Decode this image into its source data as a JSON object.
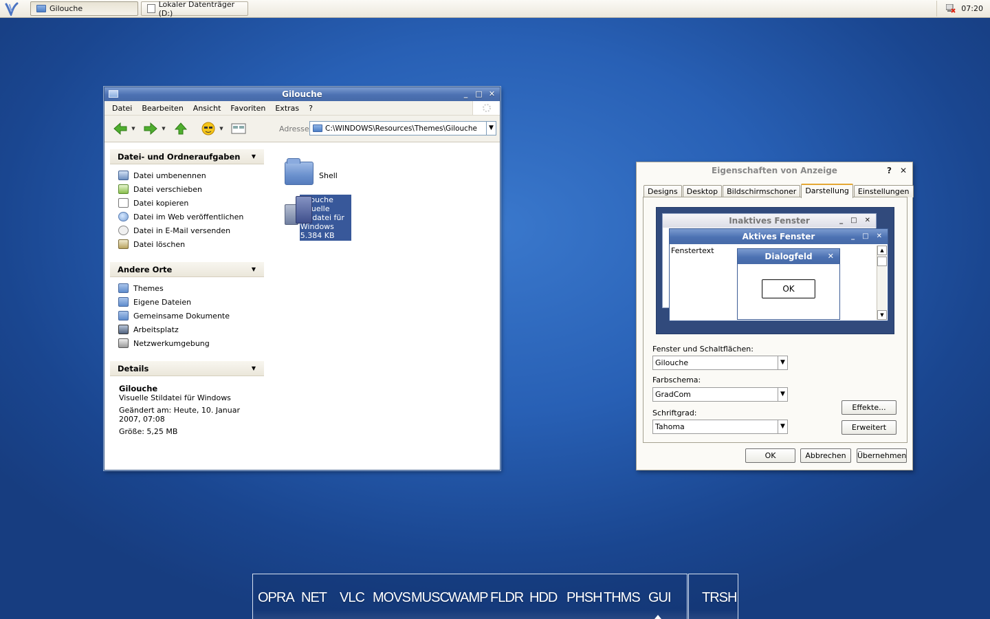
{
  "taskbar": {
    "tasks": [
      {
        "label": "Gilouche",
        "icon": "folder-icon",
        "active": true
      },
      {
        "label": "Lokaler Datenträger (D:)",
        "icon": "drive-icon",
        "active": false
      }
    ],
    "clock": "07:20"
  },
  "explorer": {
    "title": "Gilouche",
    "menu": [
      "Datei",
      "Bearbeiten",
      "Ansicht",
      "Favoriten",
      "Extras",
      "?"
    ],
    "address_label": "Adresse",
    "address_value": "C:\\WINDOWS\\Resources\\Themes\\Gilouche",
    "panels": {
      "tasks": {
        "title": "Datei- und Ordneraufgaben",
        "items": [
          "Datei umbenennen",
          "Datei verschieben",
          "Datei kopieren",
          "Datei im Web veröffentlichen",
          "Datei in E-Mail versenden",
          "Datei löschen"
        ]
      },
      "places": {
        "title": "Andere Orte",
        "items": [
          "Themes",
          "Eigene Dateien",
          "Gemeinsame Dokumente",
          "Arbeitsplatz",
          "Netzwerkumgebung"
        ]
      },
      "details": {
        "title": "Details",
        "name": "Gilouche",
        "type": "Visuelle Stildatei für Windows",
        "modified": "Geändert am: Heute, 10. Januar 2007, 07:08",
        "size": "Größe: 5,25 MB"
      }
    },
    "files": [
      {
        "name": "Shell"
      },
      {
        "name": "Gilouche",
        "type": "Visuelle Stildatei für Windows",
        "size": "5.384 KB",
        "selected": true
      }
    ]
  },
  "display_dialog": {
    "title": "Eigenschaften von Anzeige",
    "help": "?",
    "close": "✕",
    "tabs": [
      "Designs",
      "Desktop",
      "Bildschirmschoner",
      "Darstellung",
      "Einstellungen"
    ],
    "active_tab": "Darstellung",
    "preview": {
      "inactive_title": "Inaktives Fenster",
      "active_title": "Aktives Fenster",
      "window_text": "Fenstertext",
      "dialog_title": "Dialogfeld",
      "dialog_ok": "OK"
    },
    "fields": {
      "windows_buttons": {
        "label": "Fenster und Schaltflächen:",
        "value": "Gilouche"
      },
      "color_scheme": {
        "label": "Farbschema:",
        "value": "GradCom"
      },
      "font_size": {
        "label": "Schriftgrad:",
        "value": "Tahoma"
      }
    },
    "buttons": {
      "effects": "Effekte...",
      "advanced": "Erweitert",
      "ok": "OK",
      "cancel": "Abbrechen",
      "apply": "Übernehmen"
    }
  },
  "dock": {
    "items": [
      "OPRA",
      "NET",
      "VLC",
      "MOVS",
      "MUSC",
      "WAMP",
      "FLDR",
      "HDD",
      "PHSH",
      "THMS",
      "GUI"
    ],
    "trash": "TRSH"
  },
  "colors": {
    "titlebar_blue": "#4c71b2",
    "selection": "#38589a",
    "active_tab_accent": "#e4a733",
    "desktop": "#2860b5"
  }
}
